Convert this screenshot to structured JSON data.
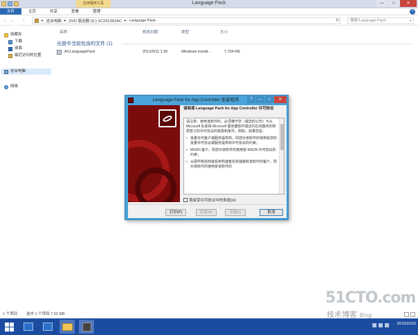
{
  "window": {
    "title": "Language Pack",
    "context_tab": "应用程序工具",
    "controls": {
      "minimize": "—",
      "maximize": "□",
      "close": "✕"
    }
  },
  "ribbon": {
    "tabs": [
      "文件",
      "主页",
      "共享",
      "查看",
      "管理"
    ],
    "help": "?"
  },
  "address": {
    "back": "←",
    "forward": "→",
    "up": "↑",
    "crumbs": [
      "这台电脑",
      "DVD 驱动器 (D:) SC2012R2AC",
      "Language Pack"
    ],
    "separator": "▸",
    "refresh": "↻",
    "search_placeholder": "搜索\"Language Pack\""
  },
  "nav": {
    "favorites": "收藏夹",
    "downloads": "下载",
    "desktop": "桌面",
    "recent": "最近访问的位置",
    "this_pc": "这台电脑",
    "network": "网络"
  },
  "columns": {
    "name": "名称",
    "modified": "修改日期",
    "type": "类型",
    "size": "大小"
  },
  "group_header": "光盘中当前包含的文件 (1)",
  "files": [
    {
      "name": "ACLanguagePack",
      "modified": "2013/9/11 1:36",
      "type": "Windows Install...",
      "size": "7,704 KB"
    }
  ],
  "status": {
    "count": "1 个项目",
    "selected": "选中 1 个项目  7.52 MB"
  },
  "taskbar": {
    "clock_date": "2013/10/23"
  },
  "watermark": {
    "line1": "51CTO.com",
    "line2": "技术博客",
    "blog": "Blog"
  },
  "dialog": {
    "title": "Language Pack for App Controller 安装程序",
    "heading": "请阅读 Language Pack for App Controller 许可协议",
    "license_paragraphs": [
      "请注意：使用该软件时，必须遵守您（或您的公司）与从 Microsoft 处获得 Microsoft 服务器软件或访问在线服务的权限签订的许可协议的条款和条件。例如，如果您是：",
      "批量许可客户或服务提供商，则您对该软件的使用受您的批量许可协议或服务提供商许可协议的约束；",
      "MSDN 客户，则您对该软件的使用受 MSDN 许可协议的约束；",
      "从硬件制造商或系统构建者处单独接收该软件的客户，则对该软件的使用受该软件的"
    ],
    "agree_label": "我接受许可协议中的条款(A)",
    "buttons": {
      "print": "打印(P)",
      "back": "后退(B)",
      "install": "安装(I)",
      "cancel": "取消"
    },
    "controls": {
      "help": "?",
      "minimize": "—",
      "maximize": "□",
      "close": "✕"
    }
  }
}
